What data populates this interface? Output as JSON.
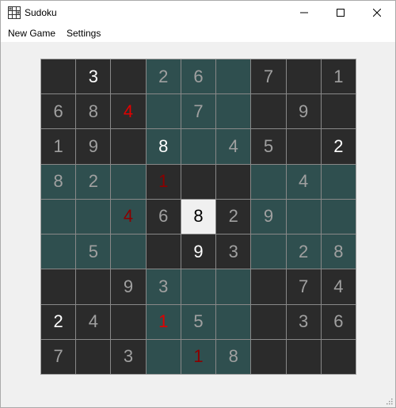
{
  "window": {
    "title": "Sudoku",
    "min_icon": "minimize-icon",
    "max_icon": "maximize-icon",
    "close_icon": "close-icon"
  },
  "menu": {
    "items": [
      "New Game",
      "Settings"
    ]
  },
  "board": {
    "colors": {
      "dark": "#2b2b2b",
      "teal": "#2f4f4f",
      "selected": "#f0f0f0",
      "given_text": "#ffffff",
      "entered_text": "#a0a0a0",
      "conflict_text": "#e00000",
      "conflict_dim_text": "#8b0000"
    },
    "rows": [
      [
        {
          "v": "",
          "bg": "dark",
          "s": ""
        },
        {
          "v": "3",
          "bg": "dark",
          "s": "given"
        },
        {
          "v": "",
          "bg": "dark",
          "s": ""
        },
        {
          "v": "2",
          "bg": "teal",
          "s": "user"
        },
        {
          "v": "6",
          "bg": "teal",
          "s": "user"
        },
        {
          "v": "",
          "bg": "teal",
          "s": ""
        },
        {
          "v": "7",
          "bg": "dark",
          "s": "user"
        },
        {
          "v": "",
          "bg": "dark",
          "s": ""
        },
        {
          "v": "1",
          "bg": "dark",
          "s": "user"
        }
      ],
      [
        {
          "v": "6",
          "bg": "dark",
          "s": "user"
        },
        {
          "v": "8",
          "bg": "dark",
          "s": "user"
        },
        {
          "v": "4",
          "bg": "dark",
          "s": "hint"
        },
        {
          "v": "",
          "bg": "teal",
          "s": ""
        },
        {
          "v": "7",
          "bg": "teal",
          "s": "user"
        },
        {
          "v": "",
          "bg": "teal",
          "s": ""
        },
        {
          "v": "",
          "bg": "dark",
          "s": ""
        },
        {
          "v": "9",
          "bg": "dark",
          "s": "user"
        },
        {
          "v": "",
          "bg": "dark",
          "s": ""
        }
      ],
      [
        {
          "v": "1",
          "bg": "dark",
          "s": "user"
        },
        {
          "v": "9",
          "bg": "dark",
          "s": "user"
        },
        {
          "v": "",
          "bg": "dark",
          "s": ""
        },
        {
          "v": "8",
          "bg": "teal",
          "s": "given"
        },
        {
          "v": "",
          "bg": "teal",
          "s": ""
        },
        {
          "v": "4",
          "bg": "teal",
          "s": "user"
        },
        {
          "v": "5",
          "bg": "dark",
          "s": "user"
        },
        {
          "v": "",
          "bg": "dark",
          "s": ""
        },
        {
          "v": "2",
          "bg": "dark",
          "s": "given"
        }
      ],
      [
        {
          "v": "8",
          "bg": "teal",
          "s": "user"
        },
        {
          "v": "2",
          "bg": "teal",
          "s": "user"
        },
        {
          "v": "",
          "bg": "teal",
          "s": ""
        },
        {
          "v": "1",
          "bg": "dark",
          "s": "hintdark"
        },
        {
          "v": "",
          "bg": "dark",
          "s": ""
        },
        {
          "v": "",
          "bg": "dark",
          "s": ""
        },
        {
          "v": "",
          "bg": "teal",
          "s": ""
        },
        {
          "v": "4",
          "bg": "teal",
          "s": "user"
        },
        {
          "v": "",
          "bg": "teal",
          "s": ""
        }
      ],
      [
        {
          "v": "",
          "bg": "teal",
          "s": ""
        },
        {
          "v": "",
          "bg": "teal",
          "s": ""
        },
        {
          "v": "4",
          "bg": "teal",
          "s": "hintdark"
        },
        {
          "v": "6",
          "bg": "dark",
          "s": "user"
        },
        {
          "v": "8",
          "bg": "sel",
          "s": "selnum"
        },
        {
          "v": "2",
          "bg": "dark",
          "s": "user"
        },
        {
          "v": "9",
          "bg": "teal",
          "s": "user"
        },
        {
          "v": "",
          "bg": "teal",
          "s": ""
        },
        {
          "v": "",
          "bg": "teal",
          "s": ""
        }
      ],
      [
        {
          "v": "",
          "bg": "teal",
          "s": ""
        },
        {
          "v": "5",
          "bg": "teal",
          "s": "user"
        },
        {
          "v": "",
          "bg": "teal",
          "s": ""
        },
        {
          "v": "",
          "bg": "dark",
          "s": ""
        },
        {
          "v": "9",
          "bg": "dark",
          "s": "given"
        },
        {
          "v": "3",
          "bg": "dark",
          "s": "user"
        },
        {
          "v": "",
          "bg": "teal",
          "s": ""
        },
        {
          "v": "2",
          "bg": "teal",
          "s": "user"
        },
        {
          "v": "8",
          "bg": "teal",
          "s": "user"
        }
      ],
      [
        {
          "v": "",
          "bg": "dark",
          "s": ""
        },
        {
          "v": "",
          "bg": "dark",
          "s": ""
        },
        {
          "v": "9",
          "bg": "dark",
          "s": "user"
        },
        {
          "v": "3",
          "bg": "teal",
          "s": "user"
        },
        {
          "v": "",
          "bg": "teal",
          "s": ""
        },
        {
          "v": "",
          "bg": "teal",
          "s": ""
        },
        {
          "v": "",
          "bg": "dark",
          "s": ""
        },
        {
          "v": "7",
          "bg": "dark",
          "s": "user"
        },
        {
          "v": "4",
          "bg": "dark",
          "s": "user"
        }
      ],
      [
        {
          "v": "2",
          "bg": "dark",
          "s": "given"
        },
        {
          "v": "4",
          "bg": "dark",
          "s": "user"
        },
        {
          "v": "",
          "bg": "dark",
          "s": ""
        },
        {
          "v": "1",
          "bg": "teal",
          "s": "hint"
        },
        {
          "v": "5",
          "bg": "teal",
          "s": "user"
        },
        {
          "v": "",
          "bg": "teal",
          "s": ""
        },
        {
          "v": "",
          "bg": "dark",
          "s": ""
        },
        {
          "v": "3",
          "bg": "dark",
          "s": "user"
        },
        {
          "v": "6",
          "bg": "dark",
          "s": "user"
        }
      ],
      [
        {
          "v": "7",
          "bg": "dark",
          "s": "user"
        },
        {
          "v": "",
          "bg": "dark",
          "s": ""
        },
        {
          "v": "3",
          "bg": "dark",
          "s": "user"
        },
        {
          "v": "",
          "bg": "teal",
          "s": ""
        },
        {
          "v": "1",
          "bg": "teal",
          "s": "hintdark"
        },
        {
          "v": "8",
          "bg": "teal",
          "s": "user"
        },
        {
          "v": "",
          "bg": "dark",
          "s": ""
        },
        {
          "v": "",
          "bg": "dark",
          "s": ""
        },
        {
          "v": "",
          "bg": "dark",
          "s": ""
        }
      ]
    ]
  }
}
